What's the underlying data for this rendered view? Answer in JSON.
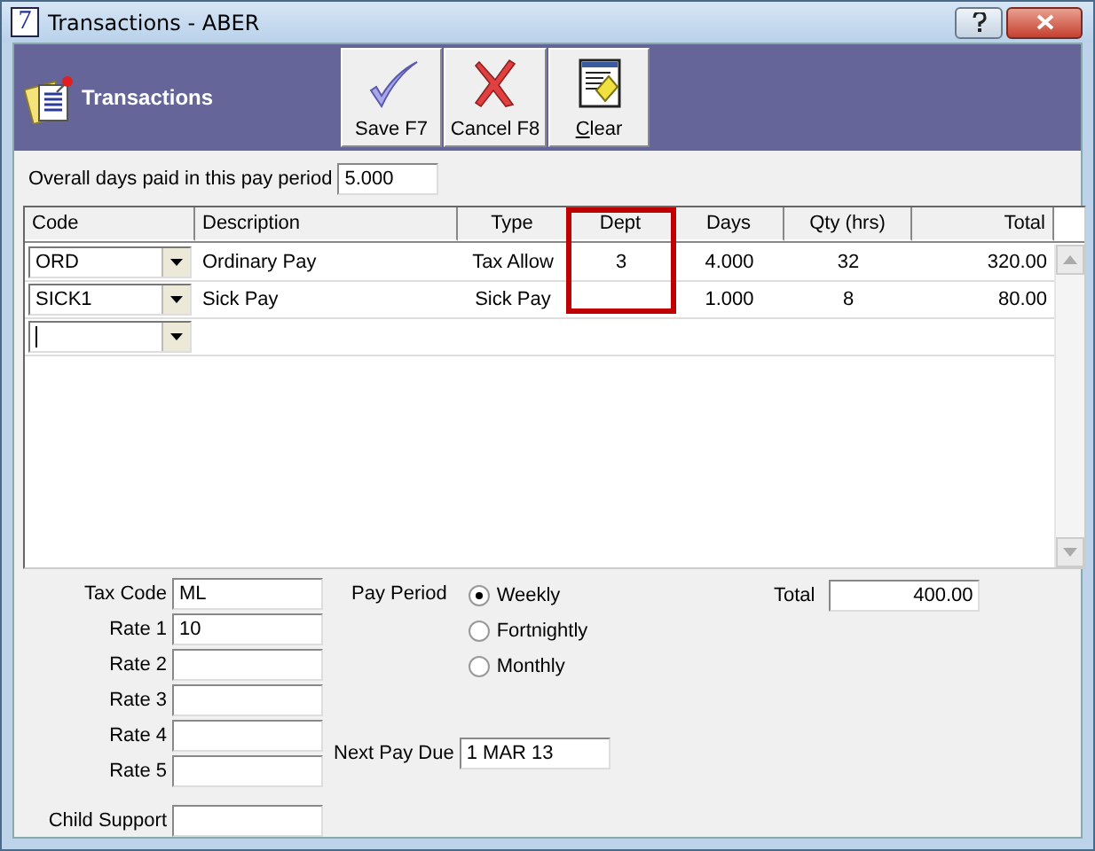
{
  "window": {
    "title": "Transactions - ABER",
    "app_icon": "7"
  },
  "toolbar": {
    "title": "Transactions",
    "buttons": [
      {
        "kind": "save",
        "label": "Save F7"
      },
      {
        "kind": "cancel",
        "label": "Cancel F8"
      },
      {
        "kind": "clear",
        "label": "Clear"
      }
    ]
  },
  "days_paid": {
    "label": "Overall days paid in this pay period",
    "value": "5.000"
  },
  "table": {
    "columns": [
      {
        "label": "Code",
        "highlighted": false
      },
      {
        "label": "Description",
        "highlighted": false
      },
      {
        "label": "Type",
        "highlighted": false
      },
      {
        "label": "Dept",
        "highlighted": true
      },
      {
        "label": "Days",
        "highlighted": false
      },
      {
        "label": "Qty (hrs)",
        "highlighted": false
      },
      {
        "label": "Total",
        "highlighted": false
      }
    ],
    "rows": [
      {
        "kind": "entry",
        "cells": [
          "ORD",
          "Ordinary Pay",
          "Tax Allow",
          "3",
          "4.000",
          "32",
          "320.00"
        ]
      },
      {
        "kind": "entry",
        "cells": [
          "SICK1",
          "Sick Pay",
          "Sick Pay",
          "",
          "1.000",
          "8",
          "80.00"
        ]
      },
      {
        "kind": "new",
        "cells": []
      }
    ]
  },
  "tax_fields": [
    {
      "label": "Tax Code",
      "value": "ML"
    },
    {
      "label": "Rate 1",
      "value": "10"
    },
    {
      "label": "Rate 2"
    },
    {
      "label": "Rate 3"
    },
    {
      "label": "Rate 4"
    },
    {
      "label": "Rate 5"
    }
  ],
  "child_support": {
    "label": "Child Support"
  },
  "pay_period": {
    "label": "Pay Period",
    "options": [
      {
        "label": "Weekly",
        "selected": true
      },
      {
        "label": "Fortnightly",
        "selected": false
      },
      {
        "label": "Monthly",
        "selected": false
      }
    ]
  },
  "next_pay_due": {
    "label": "Next Pay Due",
    "value": "1 MAR 13"
  },
  "total": {
    "label": "Total",
    "value": "400.00"
  }
}
